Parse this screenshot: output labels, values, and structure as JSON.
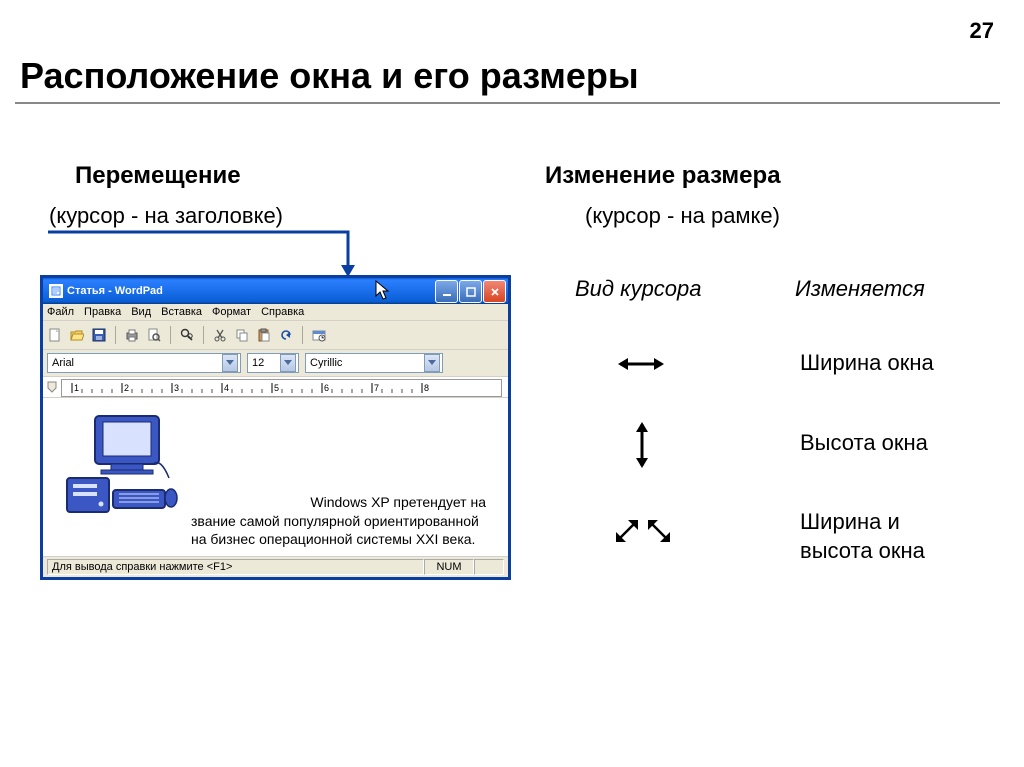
{
  "page_number": "27",
  "title": "Расположение окна и его размеры",
  "left": {
    "heading": "Перемещение",
    "sub": "(курсор - на заголовке)"
  },
  "right": {
    "heading": "Изменение размера",
    "sub": "(курсор - на рамке)",
    "col1": "Вид курсора",
    "col2": "Изменяется",
    "rows": {
      "r1": "Ширина окна",
      "r2": "Высота окна",
      "r3": "Ширина и\nвысота окна"
    }
  },
  "wordpad": {
    "title": "Статья - WordPad",
    "menus": {
      "file": "Файл",
      "edit": "Правка",
      "view": "Вид",
      "insert": "Вставка",
      "format": "Формат",
      "help": "Справка"
    },
    "font_name": "Arial",
    "font_size": "12",
    "script": "Cyrillic",
    "ruler_marks": [
      "1",
      "2",
      "3",
      "4",
      "5",
      "6",
      "7",
      "8"
    ],
    "doc_line1": "Windows XP претендует на",
    "doc_line2": "звание самой популярной ориентированной",
    "doc_line3": "на бизнес операционной системы XXI века.",
    "status_help": "Для вывода справки нажмите <F1>",
    "status_num": "NUM"
  }
}
